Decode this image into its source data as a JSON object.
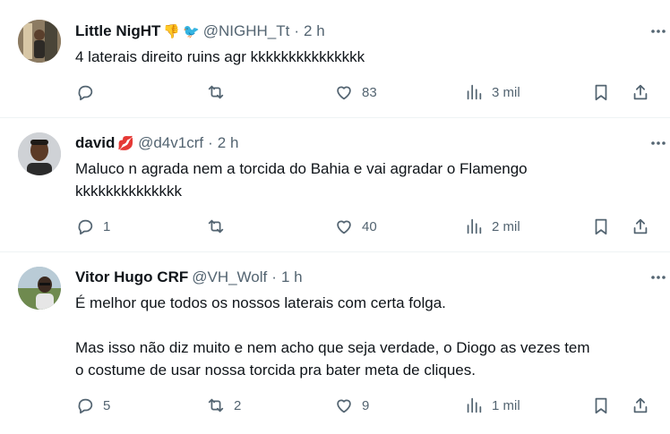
{
  "tweets": [
    {
      "name": "Little NigHT",
      "badges": [
        "👎",
        "🐦"
      ],
      "handle": "@NIGHH_Tt",
      "time": "2 h",
      "text": "4 laterais direito ruins agr kkkkkkkkkkkkkkk",
      "replies": "",
      "retweets": "",
      "likes": "83",
      "views": "3 mil"
    },
    {
      "name": "david",
      "badges": [
        "💋"
      ],
      "handle": "@d4v1crf",
      "time": "2 h",
      "text": "Maluco n agrada nem a torcida do Bahia e vai agradar o Flamengo\nkkkkkkkkkkkkkk",
      "replies": "1",
      "retweets": "",
      "likes": "40",
      "views": "2 mil"
    },
    {
      "name": "Vitor Hugo CRF",
      "badges": [],
      "handle": "@VH_Wolf",
      "time": "1 h",
      "text": "É melhor que todos os nossos laterais com certa folga.\n\nMas isso não diz muito e nem acho que seja verdade, o Diogo as vezes tem\no costume de usar nossa torcida pra bater meta de cliques.",
      "replies": "5",
      "retweets": "2",
      "likes": "9",
      "views": "1 mil"
    }
  ],
  "separator": "·",
  "colors": {
    "text": "#0f1419",
    "secondary": "#536471",
    "divider": "#eff3f4"
  },
  "icons": [
    "more-icon",
    "reply-icon",
    "retweet-icon",
    "like-icon",
    "views-icon",
    "bookmark-icon",
    "share-icon"
  ]
}
